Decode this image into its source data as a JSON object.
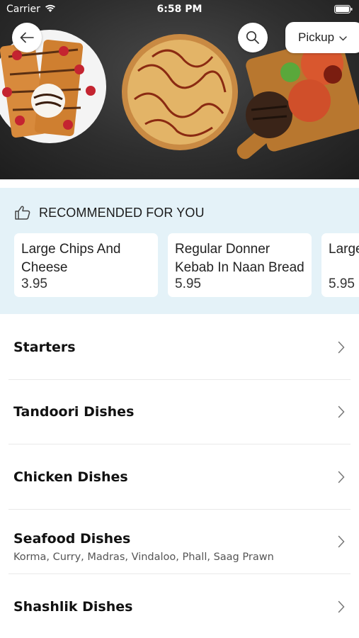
{
  "status_bar": {
    "carrier": "Carrier",
    "time": "6:58 PM"
  },
  "header": {
    "back_icon": "arrow-left-icon",
    "search_icon": "search-icon",
    "order_mode": "Pickup"
  },
  "recommended": {
    "icon": "thumbs-up-icon",
    "title": "RECOMMENDED FOR YOU",
    "items": [
      {
        "name": "Large Chips And Cheese",
        "price": "3.95"
      },
      {
        "name": "Regular Donner Kebab In Naan Bread",
        "price": "5.95"
      },
      {
        "name": "Large Meat",
        "price": "5.95"
      }
    ]
  },
  "categories": [
    {
      "name": "Starters",
      "subtitle": ""
    },
    {
      "name": "Tandoori Dishes",
      "subtitle": ""
    },
    {
      "name": "Chicken Dishes",
      "subtitle": ""
    },
    {
      "name": "Seafood Dishes",
      "subtitle": "Korma, Curry, Madras, Vindaloo, Phall, Saag Prawn"
    },
    {
      "name": "Shashlik Dishes",
      "subtitle": ""
    }
  ],
  "colors": {
    "recommended_bg": "#e4f2f8",
    "hero_bg": "#2e2e2e",
    "card_bg": "#ffffff",
    "divider": "#e9e9e9"
  }
}
